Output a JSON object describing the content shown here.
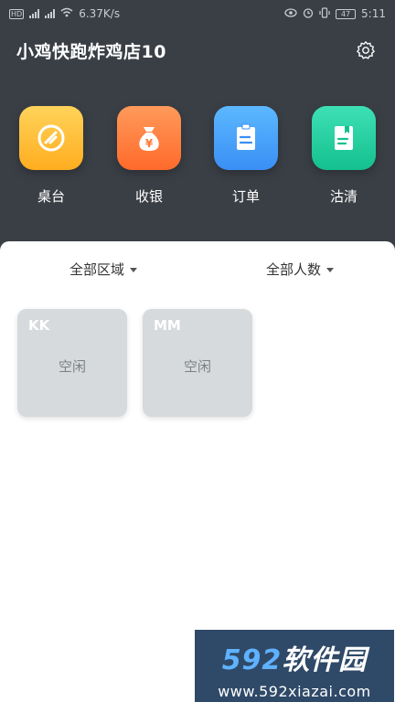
{
  "status_bar": {
    "network_speed": "6.37K/s",
    "battery": "47",
    "time": "5:11",
    "icons": [
      "hd-icon",
      "signal-4g-icon",
      "signal-4g-icon",
      "wifi-icon",
      "eye-icon",
      "alarm-icon",
      "vibrate-icon",
      "battery-icon"
    ]
  },
  "header": {
    "store_name": "小鸡快跑炸鸡店10",
    "settings_icon": "gear-icon"
  },
  "quick_actions": [
    {
      "label": "桌台",
      "icon": "table-icon",
      "color_top": "#ffd35a",
      "color_bottom": "#ffad1f"
    },
    {
      "label": "收银",
      "icon": "money-bag-icon",
      "color_top": "#ff9a5a",
      "color_bottom": "#ff6a2b"
    },
    {
      "label": "订单",
      "icon": "order-icon",
      "color_top": "#5cb8ff",
      "color_bottom": "#3a8ff5"
    },
    {
      "label": "沽清",
      "icon": "sold-out-book-icon",
      "color_top": "#3ee0b5",
      "color_bottom": "#14c08f"
    }
  ],
  "filters": {
    "area": "全部区域",
    "people": "全部人数"
  },
  "tables": [
    {
      "name": "KK",
      "status": "空闲"
    },
    {
      "name": "MM",
      "status": "空闲"
    }
  ],
  "watermark": {
    "brand_num": "592",
    "brand_text": "软件园",
    "url": "www.592xiazai.com"
  }
}
